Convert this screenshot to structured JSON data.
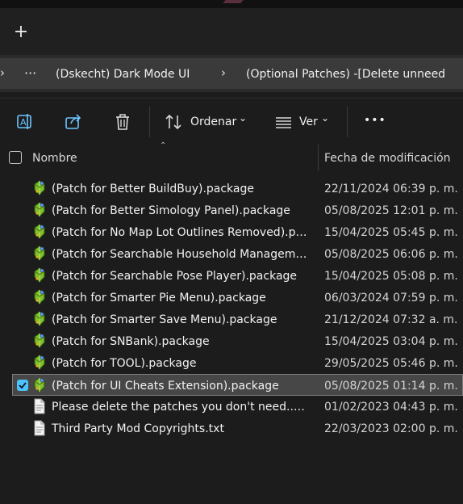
{
  "tabbar": {
    "new_tab_glyph": "+"
  },
  "address": {
    "more_label": "···",
    "crumbs": [
      "(Dskecht) Dark Mode UI",
      "(Optional Patches)  -[Delete unneed"
    ]
  },
  "toolbar": {
    "sort_label": "Ordenar",
    "view_label": "Ver",
    "more_label": "•••"
  },
  "columns": {
    "name": "Nombre",
    "date": "Fecha de modificación"
  },
  "files": [
    {
      "name": "(Patch for Better BuildBuy).package",
      "date": "22/11/2024 06:39 p. m.",
      "icon": "package-icon"
    },
    {
      "name": "(Patch for Better Simology Panel).package",
      "date": "05/08/2025 12:01 p. m.",
      "icon": "package-icon"
    },
    {
      "name": "(Patch for No Map Lot Outlines Removed).package",
      "date": "15/04/2025 05:45 p. m.",
      "icon": "package-icon"
    },
    {
      "name": "(Patch for Searchable Household Management).package",
      "date": "05/08/2025 06:06 p. m.",
      "icon": "package-icon"
    },
    {
      "name": "(Patch for Searchable Pose Player).package",
      "date": "15/04/2025 05:08 p. m.",
      "icon": "package-icon"
    },
    {
      "name": "(Patch for Smarter Pie Menu).package",
      "date": "06/03/2024 07:59 p. m.",
      "icon": "package-icon"
    },
    {
      "name": "(Patch for Smarter Save Menu).package",
      "date": "21/12/2024 07:32 a. m.",
      "icon": "package-icon"
    },
    {
      "name": "(Patch for SNBank).package",
      "date": "15/04/2025 03:04 p. m.",
      "icon": "package-icon"
    },
    {
      "name": "(Patch for TOOL).package",
      "date": "29/05/2025 05:46 p. m.",
      "icon": "package-icon"
    },
    {
      "name": "(Patch for UI Cheats Extension).package",
      "date": "05/08/2025 01:14 p. m.",
      "icon": "package-icon",
      "selected": true
    },
    {
      "name": "Please delete the patches you don't need..txt",
      "date": "01/02/2023 04:43 p. m.",
      "icon": "text-file-icon"
    },
    {
      "name": "Third Party Mod Copyrights.txt",
      "date": "22/03/2023 02:00 p. m.",
      "icon": "text-file-icon"
    }
  ],
  "colors": {
    "accent": "#4cc2ff",
    "background": "#1c1c1c",
    "selected_row": "#474747"
  }
}
